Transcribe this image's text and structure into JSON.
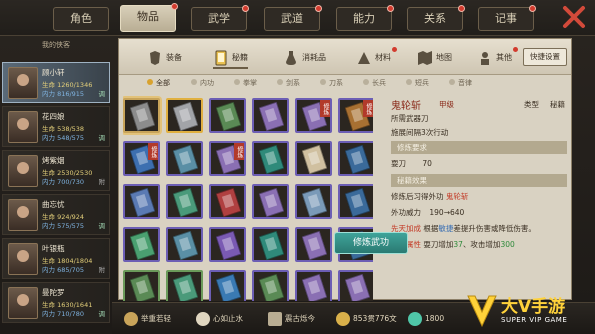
{
  "top_tabs": [
    {
      "label": "角色",
      "dot": false
    },
    {
      "label": "物品",
      "dot": true,
      "active": true
    },
    {
      "label": "武学",
      "dot": true
    },
    {
      "label": "武道",
      "dot": true
    },
    {
      "label": "能力",
      "dot": true
    },
    {
      "label": "关系",
      "dot": true
    },
    {
      "label": "记事",
      "dot": true
    }
  ],
  "party": {
    "header": "我的侠客",
    "members": [
      {
        "name": "顾小轩",
        "hp": "生命 1260/1346",
        "mp": "内力 816/915",
        "tag": "调"
      },
      {
        "name": "花四娘",
        "hp": "生命 538/538",
        "mp": "内力 548/575",
        "tag": "调"
      },
      {
        "name": "烤紫烟",
        "hp": "生命 2530/2530",
        "mp": "内力 700/730",
        "tag": "附"
      },
      {
        "name": "曲忘忧",
        "hp": "生命 924/924",
        "mp": "内力 575/575",
        "tag": "调"
      },
      {
        "name": "叶银瓶",
        "hp": "生命 1804/1804",
        "mp": "内力 685/705",
        "tag": "附"
      },
      {
        "name": "曼陀罗",
        "hp": "生命 1630/1641",
        "mp": "内力 710/780",
        "tag": "调"
      }
    ]
  },
  "categories": [
    {
      "label": "装备",
      "icon": "armor-icon"
    },
    {
      "label": "秘籍",
      "icon": "scroll-icon",
      "active": true
    },
    {
      "label": "消耗品",
      "icon": "potion-icon"
    },
    {
      "label": "材料",
      "icon": "material-icon",
      "dot": true
    },
    {
      "label": "地图",
      "icon": "map-icon"
    },
    {
      "label": "其他",
      "icon": "misc-icon",
      "dot": true
    }
  ],
  "quick_settings": "快捷设置",
  "filters": [
    "全部",
    "内功",
    "拳掌",
    "剑系",
    "刀系",
    "长兵",
    "短兵",
    "音律"
  ],
  "active_filter": "全部",
  "grid": [
    [
      {
        "c": "#8c8c8c",
        "b": "sel"
      },
      {
        "c": "#a2a4a8",
        "b": "gold"
      },
      {
        "c": "#5a8a55"
      },
      {
        "c": "#8a6fb3"
      },
      {
        "c": "#8a6fb3",
        "mark": "修炼"
      },
      {
        "c": "#a87032",
        "mark": "修炼"
      }
    ],
    [
      {
        "c": "#3d6fb0",
        "mark": "修炼"
      },
      {
        "c": "#5a8fa5"
      },
      {
        "c": "#8a6fb3",
        "mark": "修炼"
      },
      {
        "c": "#2f8a7a"
      },
      {
        "c": "#d0c0a0"
      },
      {
        "c": "#3a6a9a"
      }
    ],
    [
      {
        "c": "#5a7ab3"
      },
      {
        "c": "#4a9a7a"
      },
      {
        "c": "#b04040"
      },
      {
        "c": "#8a6fb3"
      },
      {
        "c": "#7a9ab8"
      },
      {
        "c": "#3a6a9a"
      }
    ],
    [
      {
        "c": "#4aa070"
      },
      {
        "c": "#5a8fa5"
      },
      {
        "c": "#7a5ab3"
      },
      {
        "c": "#2f8a7a"
      },
      {
        "c": "#8a6fb3"
      },
      {
        "c": "#3a6a9a"
      }
    ],
    [
      {
        "c": "#5a8a55",
        "b": "green"
      },
      {
        "c": "#4a9a7a",
        "b": "green"
      },
      {
        "c": "#3a7ab3"
      },
      {
        "c": "#5a8a55"
      },
      {
        "c": "#8a6fb3"
      },
      {
        "c": "#8a6fb3"
      }
    ]
  ],
  "detail": {
    "name": "鬼轮斩",
    "grade": "甲级",
    "type_label": "类型",
    "type_value": "秘籍",
    "req_weapon": "所需武器刀",
    "cooldown": "施展间隔3次行动",
    "section_req": "修炼要求",
    "req_skill": "耍刀",
    "req_value": "70",
    "section_effect": "秘籍效果",
    "effect_1a": "修炼后习得外功",
    "effect_1b": "鬼轮斩",
    "effect_2a": "外功威力",
    "effect_2b": "190→640",
    "effect_3a": "先天加成",
    "effect_3b": "根据",
    "effect_3c": "敏捷",
    "effect_3d": "差提升伤害或降低伤害。",
    "effect_4a": "满重属性",
    "effect_4b": "耍刀增加",
    "effect_4c": "37",
    "effect_4d": "、攻击增加",
    "effect_4e": "300"
  },
  "train_button": "修炼武功",
  "bottom": [
    {
      "icon": "weight-icon",
      "text": "举重若轻"
    },
    {
      "icon": "face-icon",
      "text": "心如止水"
    },
    {
      "icon": "scroll-icon",
      "text": "震古烁今"
    },
    {
      "icon": "coin-icon",
      "text": "853贯776文"
    },
    {
      "icon": "gem-icon",
      "text": "1800"
    }
  ],
  "watermark": {
    "title": "大V手游",
    "sub": "SUPER VIP GAME"
  }
}
